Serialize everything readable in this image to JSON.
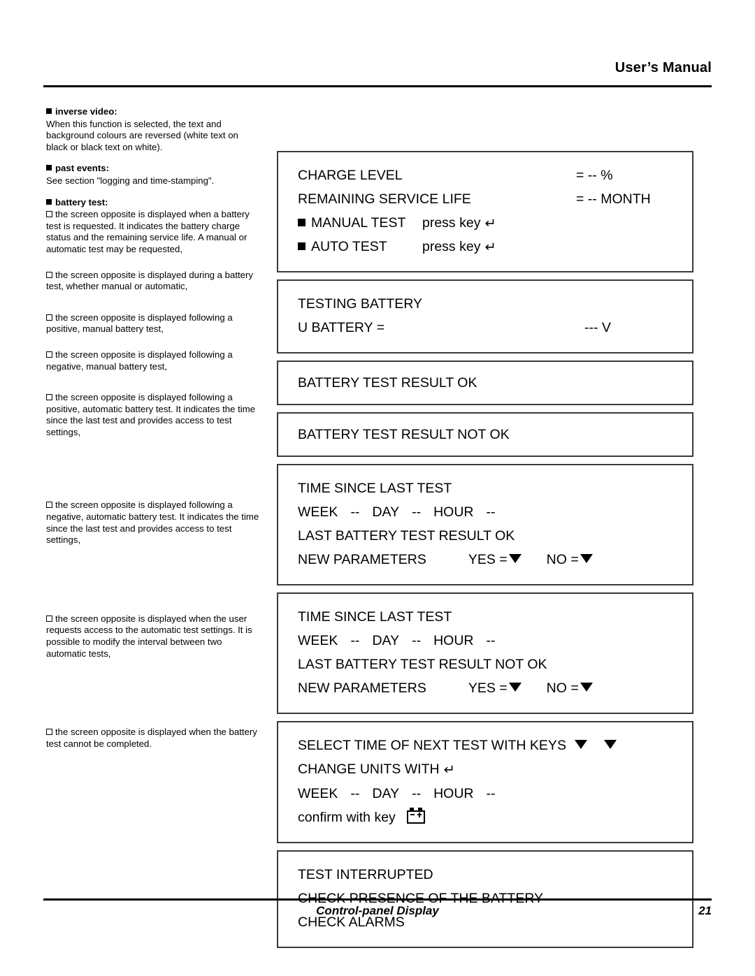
{
  "header": {
    "title": "User’s Manual"
  },
  "left_column": {
    "sections": [
      {
        "heading": "inverse video:",
        "body": "When this function is selected, the text and background colours are reversed (white text on black or black text on white)."
      },
      {
        "heading": "past events:",
        "body": "See section \"logging and time-stamping\"."
      },
      {
        "heading": "battery test:",
        "body": ""
      }
    ],
    "items": [
      "the screen opposite is displayed when a battery test is requested. It indicates the battery charge status and the remaining service life. A manual or automatic test may be requested,",
      "the screen opposite is displayed during a battery test, whether manual or automatic,",
      "the screen opposite is displayed following a positive, manual battery test,",
      "the screen opposite is displayed following a negative, manual battery test,",
      "the screen opposite is displayed following a positive, automatic battery test. It indicates the time since the last test and provides access to test settings,",
      "the screen opposite is displayed following a negative, automatic battery test. It indicates the time since the last test and provides access to test settings,",
      "the screen opposite is displayed when the user requests access to the automatic test settings. It is possible to modify the interval between two automatic tests,",
      "the screen opposite is displayed when the battery test cannot be completed."
    ]
  },
  "panels": {
    "p1": {
      "row1_label": "CHARGE LEVEL",
      "row1_value": "= -- %",
      "row2_label": "REMAINING SERVICE LIFE",
      "row2_value": "= -- MONTH",
      "row3_label": "MANUAL TEST",
      "row3_key": "press key",
      "row4_label": "AUTO TEST",
      "row4_key": "press key"
    },
    "p2": {
      "row1": "TESTING BATTERY",
      "row2_label": "U BATTERY =",
      "row2_value": "--- V"
    },
    "p3": {
      "row1": "BATTERY TEST RESULT OK"
    },
    "p4": {
      "row1": "BATTERY TEST RESULT NOT OK"
    },
    "p5": {
      "row1": "TIME SINCE LAST TEST",
      "row2_week": "WEEK",
      "row2_week_val": "--",
      "row2_day": "DAY",
      "row2_day_val": "--",
      "row2_hour": "HOUR",
      "row2_hour_val": "--",
      "row3": "LAST BATTERY TEST RESULT OK",
      "row4_label": "NEW PARAMETERS",
      "row4_yes": "YES =",
      "row4_no": "NO ="
    },
    "p6": {
      "row1": "TIME SINCE LAST TEST",
      "row2_week": "WEEK",
      "row2_week_val": "--",
      "row2_day": "DAY",
      "row2_day_val": "--",
      "row2_hour": "HOUR",
      "row2_hour_val": "--",
      "row3": "LAST BATTERY TEST RESULT NOT OK",
      "row4_label": "NEW PARAMETERS",
      "row4_yes": "YES =",
      "row4_no": "NO ="
    },
    "p7": {
      "row1": "SELECT TIME OF NEXT TEST WITH KEYS",
      "row2": "CHANGE UNITS WITH",
      "row3_week": "WEEK",
      "row3_week_val": "--",
      "row3_day": "DAY",
      "row3_day_val": "--",
      "row3_hour": "HOUR",
      "row3_hour_val": "--",
      "row4": "confirm with key"
    },
    "p8": {
      "row1": "TEST INTERRUPTED",
      "row2": "CHECK PRESENCE OF THE BATTERY",
      "row3": "CHECK ALARMS"
    }
  },
  "icons": {
    "enter_key": "↵",
    "bullet_filled": "filled-square",
    "bullet_hollow": "hollow-square",
    "down_triangle": "down-triangle",
    "confirm_key": "battery-icon"
  },
  "footer": {
    "caption": "Control-panel Display",
    "page": "21"
  }
}
